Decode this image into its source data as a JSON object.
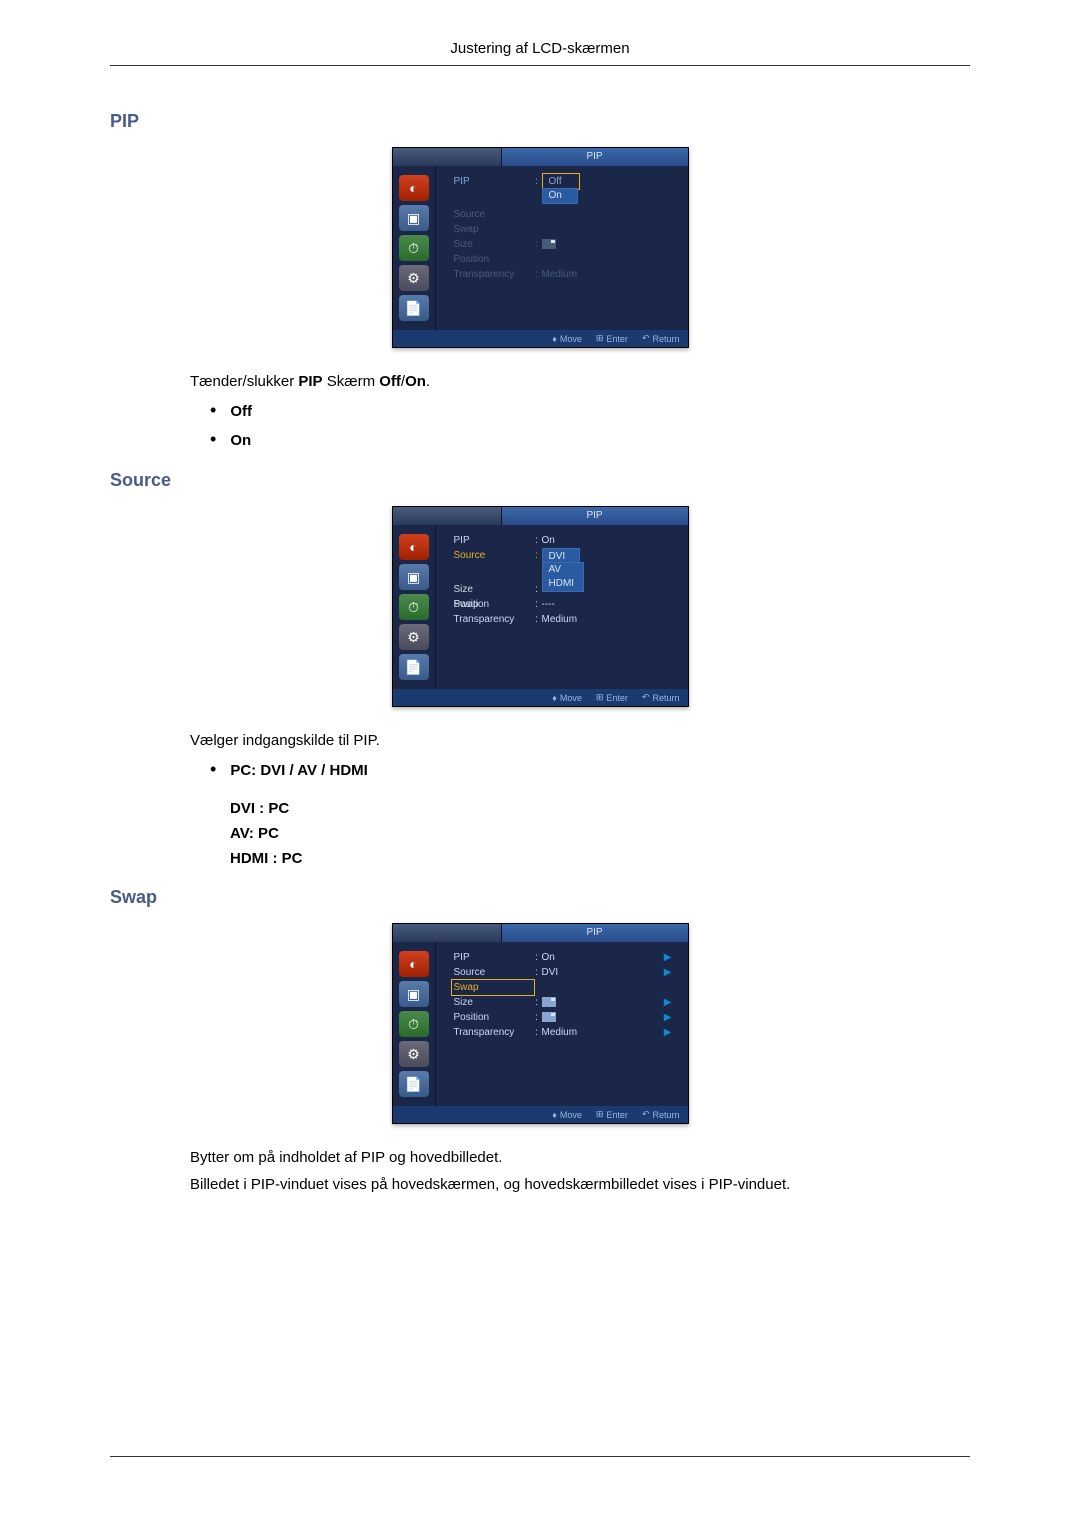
{
  "header": "Justering af LCD-skærmen",
  "sections": {
    "pip": {
      "heading": "PIP",
      "text": "Tænder/slukker PIP Skærm Off/On.",
      "bullets": [
        "Off",
        "On"
      ]
    },
    "source": {
      "heading": "Source",
      "text": "Vælger indgangskilde til PIP.",
      "bullet_line": "PC: DVI / AV / HDMI",
      "indent_items": [
        "DVI : PC",
        "AV: PC",
        "HDMI : PC"
      ]
    },
    "swap": {
      "heading": "Swap",
      "text1": "Bytter om på indholdet af PIP og hovedbilledet.",
      "text2": "Billedet i PIP-vinduet vises på hovedskærmen, og hovedskærmbilledet vises i PIP-vinduet."
    }
  },
  "osd": {
    "title": "PIP",
    "menu_labels": [
      "PIP",
      "Source",
      "Swap",
      "Size",
      "Position",
      "Transparency"
    ],
    "pip_screen": {
      "pip_value": "Off",
      "drop_value": "On",
      "transparency": "Medium"
    },
    "source_screen": {
      "pip_value": "On",
      "source_value": "DVI",
      "drop_values": [
        "AV",
        "HDMI"
      ],
      "transparency": "Medium",
      "position_value": "----"
    },
    "swap_screen": {
      "pip_value": "On",
      "source_value": "DVI",
      "transparency": "Medium"
    },
    "footer": {
      "move": "Move",
      "enter": "Enter",
      "return": "Return"
    }
  }
}
